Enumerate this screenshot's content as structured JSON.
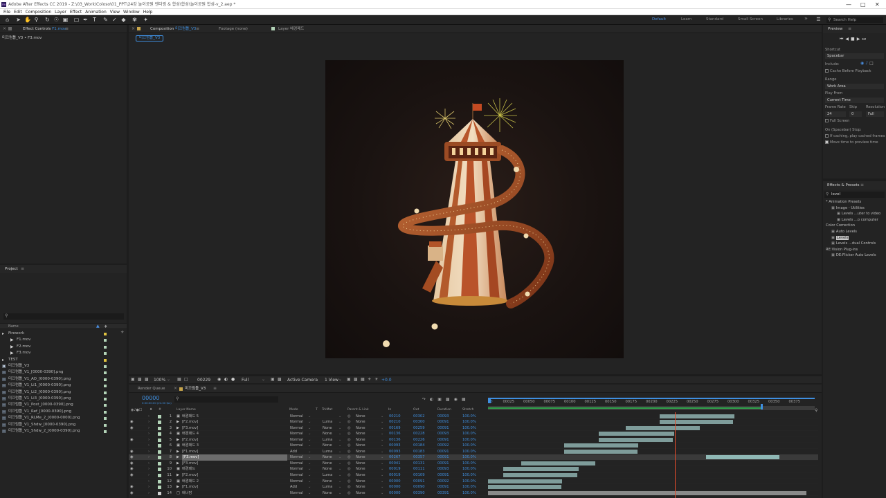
{
  "window": {
    "title": "Adobe After Effects CC 2019 - Z:\\03_Work\\Coloso\\01_PPT\\24강 놀이공원 렌더링 & 합성\\합성\\놀이공원 합성-v_2.aep *",
    "logo": "Ae"
  },
  "menu": [
    "File",
    "Edit",
    "Composition",
    "Layer",
    "Effect",
    "Animation",
    "View",
    "Window",
    "Help"
  ],
  "workspaces": {
    "default": "Default",
    "learn": "Learn",
    "standard": "Standard",
    "small_screen": "Small Screen",
    "libraries": "Libraries",
    "more": "»"
  },
  "search_help": "Search Help",
  "effect_controls": {
    "tab": "Effect Controls",
    "tab_file": "F1.mov",
    "breadcrumb": "미끄럼틀_V3 • F3.mov"
  },
  "composition_panel": {
    "comp_tab": "Composition",
    "comp_name": "미끄럼틀_V3",
    "footage_tab": "Footage  (none)",
    "layer_tab": "Layer  배경패드",
    "comp_pill": "미끄럼틀_V3"
  },
  "viewer_bar": {
    "zoom": "100%",
    "timecode": "00229",
    "resolution": "Full",
    "camera": "Active Camera",
    "view": "1 View",
    "exposure": "+0.0"
  },
  "project": {
    "title": "Project",
    "search_placeholder": "",
    "col_name": "Name",
    "items": [
      {
        "indent": 0,
        "label": "Firework",
        "kind": "folder",
        "tag": "#e0c340"
      },
      {
        "indent": 1,
        "label": "F1.mov",
        "kind": "footage",
        "tag": "#b3d4b8"
      },
      {
        "indent": 1,
        "label": "F2.mov",
        "kind": "footage",
        "tag": "#b3d4b8"
      },
      {
        "indent": 1,
        "label": "F3.mov",
        "kind": "footage",
        "tag": "#b3d4b8"
      },
      {
        "indent": 0,
        "label": "TEST",
        "kind": "folder",
        "tag": "#e0c340"
      },
      {
        "indent": 0,
        "label": "미끄럼틀_V3",
        "kind": "comp",
        "tag": "#b3d4b8"
      },
      {
        "indent": 0,
        "label": "미끄럼틀_V1_[0000-0390].png",
        "kind": "seq",
        "tag": "#b3d4b8"
      },
      {
        "indent": 0,
        "label": "미끄럼틀_V1_AO_[0000-0390].png",
        "kind": "seq",
        "tag": "#b3d4b8"
      },
      {
        "indent": 0,
        "label": "미끄럼틀_V1_Li1_[0000-0390].png",
        "kind": "seq",
        "tag": "#b3d4b8"
      },
      {
        "indent": 0,
        "label": "미끄럼틀_V1_Li2_[0000-0390].png",
        "kind": "seq",
        "tag": "#b3d4b8"
      },
      {
        "indent": 0,
        "label": "미끄럼틀_V1_Li3_[0000-0390].png",
        "kind": "seq",
        "tag": "#b3d4b8"
      },
      {
        "indent": 0,
        "label": "미끄럼틀_V1_Post_[0000-0390].png",
        "kind": "seq",
        "tag": "#b3d4b8"
      },
      {
        "indent": 0,
        "label": "미끄럼틀_V1_Ref_[0000-0390].png",
        "kind": "seq",
        "tag": "#b3d4b8"
      },
      {
        "indent": 0,
        "label": "미끄럼틀_V1_RLMe_2_[0000-0000].png",
        "kind": "seq",
        "tag": "#b3d4b8"
      },
      {
        "indent": 0,
        "label": "미끄럼틀_V1_Shdw_[0000-0390].png",
        "kind": "seq",
        "tag": "#b3d4b8"
      },
      {
        "indent": 0,
        "label": "미끄럼틀_V1_Shdw_2_[0000-0390].png",
        "kind": "seq",
        "tag": "#b3d4b8"
      }
    ]
  },
  "preview": {
    "title": "Preview",
    "shortcut_label": "Shortcut",
    "shortcut_value": "Spacebar",
    "include_label": "Include:",
    "cache_label": "Cache Before Playback",
    "range_label": "Range",
    "range_value": "Work Area",
    "playfrom_label": "Play From",
    "playfrom_value": "Current Time",
    "framerate_label": "Frame Rate",
    "skip_label": "Skip",
    "resolution_label": "Resolution",
    "framerate_value": "24",
    "skip_value": "0",
    "resolution_value": "Full",
    "fullscreen_label": "Full Screen",
    "stop_label": "On (Spacebar) Stop:",
    "ifcaching_label": "If caching, play cached frames",
    "movetime_label": "Move time to preview time"
  },
  "effects_presets": {
    "title": "Effects & Presets",
    "search_value": "level",
    "lines": [
      {
        "indent": 0,
        "text": "* Animation Presets"
      },
      {
        "indent": 1,
        "text": "Image - Utilities"
      },
      {
        "indent": 2,
        "text": "Levels ...uter to video"
      },
      {
        "indent": 2,
        "text": "Levels ...o computer"
      },
      {
        "indent": 0,
        "text": "Color Correction"
      },
      {
        "indent": 1,
        "text": "Auto Levels"
      },
      {
        "indent": 1,
        "text": "Levels",
        "highlight": true
      },
      {
        "indent": 1,
        "text": "Levels ...dual Controls"
      },
      {
        "indent": 0,
        "text": "RE:Vision Plug-ins"
      },
      {
        "indent": 1,
        "text": "DE:Flicker Auto Levels"
      }
    ]
  },
  "timeline": {
    "render_queue_tab": "Render Queue",
    "comp_tab": "미끄럼틀_V3",
    "timecode": "00000",
    "timecode_sub": "0:00:00:00 (24.00 fps)",
    "search_placeholder": "",
    "headers": {
      "layer_name": "Layer Name",
      "mode": "Mode",
      "t": "T",
      "trkmat": "TrkMat",
      "parent": "Parent & Link",
      "in": "In",
      "out": "Out",
      "duration": "Duration",
      "stretch": "Stretch"
    },
    "ruler": [
      "00025",
      "00050",
      "00075",
      "00100",
      "00125",
      "00150",
      "00175",
      "00200",
      "00225",
      "00250",
      "00275",
      "00300",
      "00325",
      "00350",
      "00375"
    ],
    "ruler_start": "00",
    "ruler_end": 400,
    "current_frame": 229,
    "work_area_end": 335,
    "layers": [
      {
        "num": "1",
        "name": "배경패드 5",
        "type": "comp",
        "mode": "Normal",
        "trkmat": "",
        "parent": "None",
        "in": "00210",
        "out": "00302",
        "dur": "00093",
        "stretch": "100.0%",
        "color": "#b3d4b8",
        "eye": false
      },
      {
        "num": "2",
        "name": "[F2.mov]",
        "type": "footage",
        "mode": "Normal",
        "trkmat": "Luma",
        "parent": "None",
        "in": "00210",
        "out": "00300",
        "dur": "00091",
        "stretch": "100.0%",
        "color": "#b3d4b8",
        "eye": true
      },
      {
        "num": "3",
        "name": "[F3.mov]",
        "type": "footage",
        "mode": "Normal",
        "trkmat": "None",
        "parent": "None",
        "in": "00169",
        "out": "00259",
        "dur": "00091",
        "stretch": "100.0%",
        "color": "#b3d4b8",
        "eye": true
      },
      {
        "num": "4",
        "name": "배경패드 4",
        "type": "comp",
        "mode": "Normal",
        "trkmat": "None",
        "parent": "None",
        "in": "00136",
        "out": "00228",
        "dur": "00093",
        "stretch": "100.0%",
        "color": "#b3d4b8",
        "eye": false
      },
      {
        "num": "5",
        "name": "[F2.mov]",
        "type": "footage",
        "mode": "Normal",
        "trkmat": "Luma",
        "parent": "None",
        "in": "00136",
        "out": "00226",
        "dur": "00091",
        "stretch": "100.0%",
        "color": "#b3d4b8",
        "eye": true
      },
      {
        "num": "6",
        "name": "배경패드 3",
        "type": "comp",
        "mode": "Normal",
        "trkmat": "None",
        "parent": "None",
        "in": "00093",
        "out": "00184",
        "dur": "00092",
        "stretch": "100.0%",
        "color": "#b3d4b8",
        "eye": false
      },
      {
        "num": "7",
        "name": "[F1.mov]",
        "type": "footage",
        "mode": "Add",
        "trkmat": "Luma",
        "parent": "None",
        "in": "00093",
        "out": "00183",
        "dur": "00091",
        "stretch": "100.0%",
        "color": "#b3d4b8",
        "eye": true
      },
      {
        "num": "8",
        "name": "[F3.mov]",
        "type": "footage",
        "mode": "Normal",
        "trkmat": "None",
        "parent": "None",
        "in": "00267",
        "out": "00357",
        "dur": "00091",
        "stretch": "100.0%",
        "color": "#b3d4b8",
        "eye": true,
        "selected": true
      },
      {
        "num": "9",
        "name": "[F3.mov]",
        "type": "footage",
        "mode": "Normal",
        "trkmat": "None",
        "parent": "None",
        "in": "00041",
        "out": "00131",
        "dur": "00091",
        "stretch": "100.0%",
        "color": "#b3d4b8",
        "eye": true
      },
      {
        "num": "10",
        "name": "배경패드",
        "type": "comp",
        "mode": "Normal",
        "trkmat": "None",
        "parent": "None",
        "in": "00019",
        "out": "00111",
        "dur": "00093",
        "stretch": "100.0%",
        "color": "#b3d4b8",
        "eye": true
      },
      {
        "num": "11",
        "name": "[F2.mov]",
        "type": "footage",
        "mode": "Normal",
        "trkmat": "Luma",
        "parent": "None",
        "in": "00019",
        "out": "00109",
        "dur": "00091",
        "stretch": "100.0%",
        "color": "#b3d4b8",
        "eye": true
      },
      {
        "num": "12",
        "name": "배경패드 2",
        "type": "comp",
        "mode": "Normal",
        "trkmat": "None",
        "parent": "None",
        "in": "00000",
        "out": "00091",
        "dur": "00092",
        "stretch": "100.0%",
        "color": "#b3d4b8",
        "eye": false
      },
      {
        "num": "13",
        "name": "[F1.mov]",
        "type": "footage",
        "mode": "Add",
        "trkmat": "Luma",
        "parent": "None",
        "in": "00000",
        "out": "00090",
        "dur": "00091",
        "stretch": "100.0%",
        "color": "#b3d4b8",
        "eye": true
      },
      {
        "num": "14",
        "name": "배너맘",
        "type": "solid",
        "mode": "Normal",
        "trkmat": "None",
        "parent": "None",
        "in": "00000",
        "out": "00390",
        "dur": "00391",
        "stretch": "100.0%",
        "color": "#d0d0d0",
        "eye": true
      }
    ]
  },
  "colors": {
    "accent": "#3f8fe0",
    "playhead": "#e04b2b",
    "bar": "#7e9c9a",
    "work_area": "#2fa34b",
    "tag_yellow": "#e0c340",
    "tag_green": "#b3d4b8"
  }
}
